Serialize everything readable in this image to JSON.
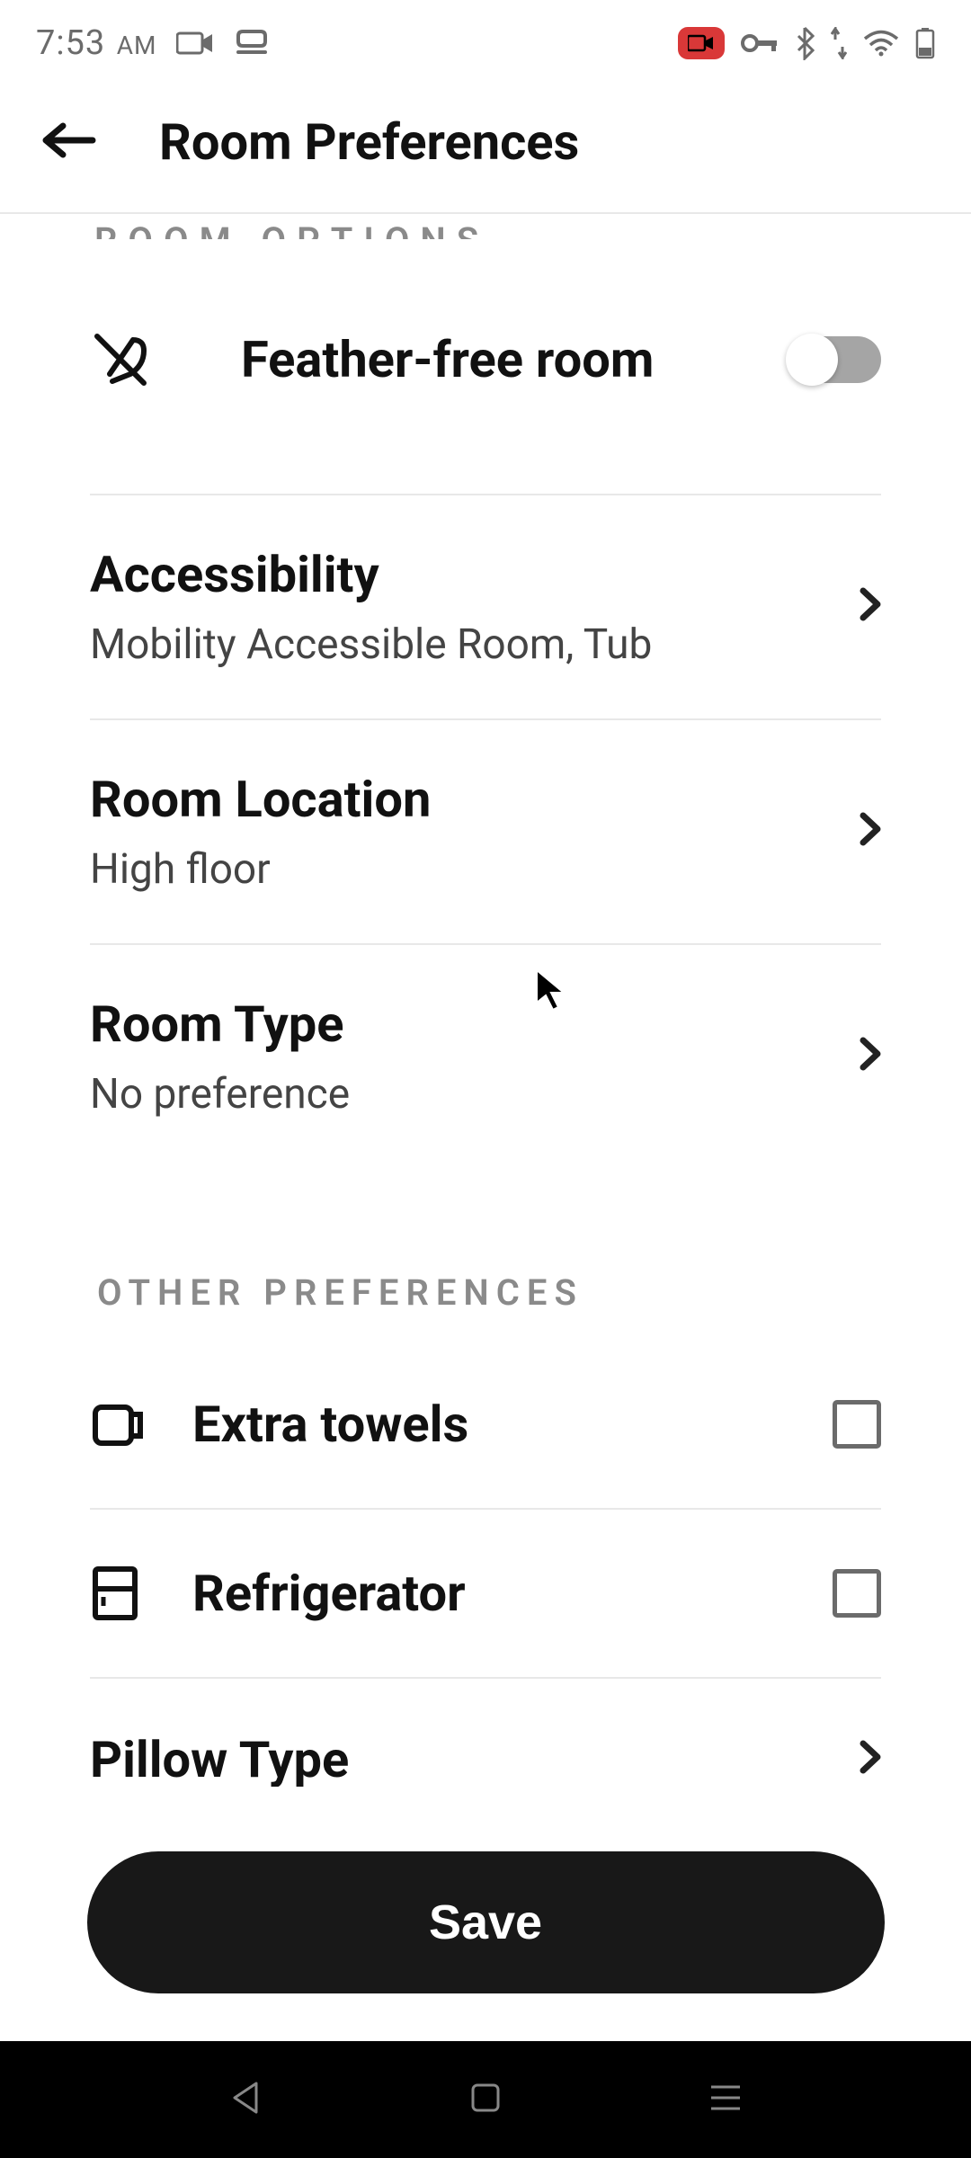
{
  "status": {
    "time": "7:53",
    "period": "AM"
  },
  "header": {
    "title": "Room Preferences"
  },
  "cutoff_section_label": "ROOM OPTIONS",
  "options": {
    "feather_free": {
      "label": "Feather-free room",
      "enabled": false
    },
    "accessibility": {
      "title": "Accessibility",
      "value": "Mobility Accessible Room, Tub"
    },
    "room_location": {
      "title": "Room Location",
      "value": "High floor"
    },
    "room_type": {
      "title": "Room Type",
      "value": "No preference"
    }
  },
  "other_section_label": "OTHER PREFERENCES",
  "other": {
    "extra_towels": {
      "label": "Extra towels",
      "checked": false
    },
    "refrigerator": {
      "label": "Refrigerator",
      "checked": false
    },
    "pillow_type": {
      "title": "Pillow Type"
    }
  },
  "actions": {
    "save": "Save"
  }
}
